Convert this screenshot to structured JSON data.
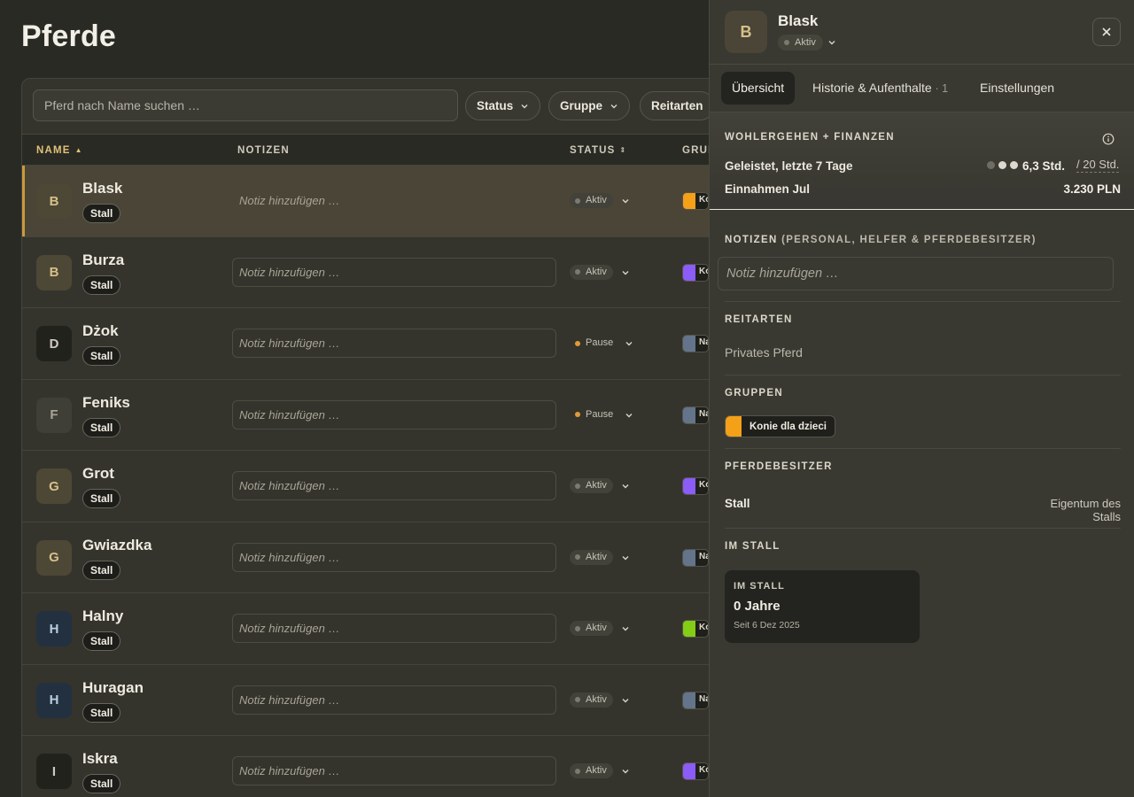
{
  "page": {
    "title": "Pferde"
  },
  "toolbar": {
    "search_placeholder": "Pferd nach Name suchen …",
    "filters": [
      "Status",
      "Gruppe",
      "Reitarten"
    ]
  },
  "table": {
    "columns": [
      "NAME",
      "NOTIZEN",
      "STATUS",
      "GRUPPEN"
    ],
    "note_placeholder": "Notiz hinzufügen …",
    "rows": [
      {
        "initial": "B",
        "name": "Blask",
        "tag": "Stall",
        "status": "Aktiv",
        "group_color": "#f4a019",
        "group_short": "Ko"
      },
      {
        "initial": "B",
        "name": "Burza",
        "tag": "Stall",
        "status": "Aktiv",
        "group_color": "#8b5cf6",
        "group_short": "Ko"
      },
      {
        "initial": "D",
        "name": "Dżok",
        "tag": "Stall",
        "status": "Pause",
        "group_color": "#64748b",
        "group_short": "Na"
      },
      {
        "initial": "F",
        "name": "Feniks",
        "tag": "Stall",
        "status": "Pause",
        "group_color": "#64748b",
        "group_short": "Na"
      },
      {
        "initial": "G",
        "name": "Grot",
        "tag": "Stall",
        "status": "Aktiv",
        "group_color": "#8b5cf6",
        "group_short": "Ko"
      },
      {
        "initial": "G",
        "name": "Gwiazdka",
        "tag": "Stall",
        "status": "Aktiv",
        "group_color": "#64748b",
        "group_short": "Na"
      },
      {
        "initial": "H",
        "name": "Halny",
        "tag": "Stall",
        "status": "Aktiv",
        "group_color": "#84cc16",
        "group_short": "Ko"
      },
      {
        "initial": "H",
        "name": "Huragan",
        "tag": "Stall",
        "status": "Aktiv",
        "group_color": "#64748b",
        "group_short": "Na"
      },
      {
        "initial": "I",
        "name": "Iskra",
        "tag": "Stall",
        "status": "Aktiv",
        "group_color": "#8b5cf6",
        "group_short": "Ko"
      }
    ]
  },
  "drawer": {
    "initial": "B",
    "name": "Blask",
    "status": "Aktiv",
    "tabs": [
      {
        "label": "Übersicht"
      },
      {
        "label": "Historie & Aufenthalte",
        "count": "· 1"
      },
      {
        "label": "Einstellungen"
      }
    ],
    "wellbeing": {
      "title": "WOHLERGEHEN + FINANZEN",
      "worked_label": "Geleistet, letzte 7 Tage",
      "worked_value": "6,3 Std.",
      "worked_limit": "/ 20 Std.",
      "income_label": "Einnahmen Jul",
      "income_value": "3.230 PLN"
    },
    "notes": {
      "title": "NOTIZEN",
      "subtitle": "(PERSONAL, HELFER & PFERDEBESITZER)",
      "placeholder": "Notiz hinzufügen …"
    },
    "riding": {
      "title": "REITARTEN",
      "value": "Privates Pferd"
    },
    "groups": {
      "title": "GRUPPEN",
      "value": "Konie dla dzieci",
      "color": "#f4a019"
    },
    "owners": {
      "title": "PFERDEBESITZER",
      "name": "Stall",
      "type": "Eigentum des Stalls"
    },
    "in_stable": {
      "title": "IM STALL",
      "card_title": "IM STALL",
      "value": "0 Jahre",
      "since": "Seit 6 Dez 2025"
    }
  }
}
